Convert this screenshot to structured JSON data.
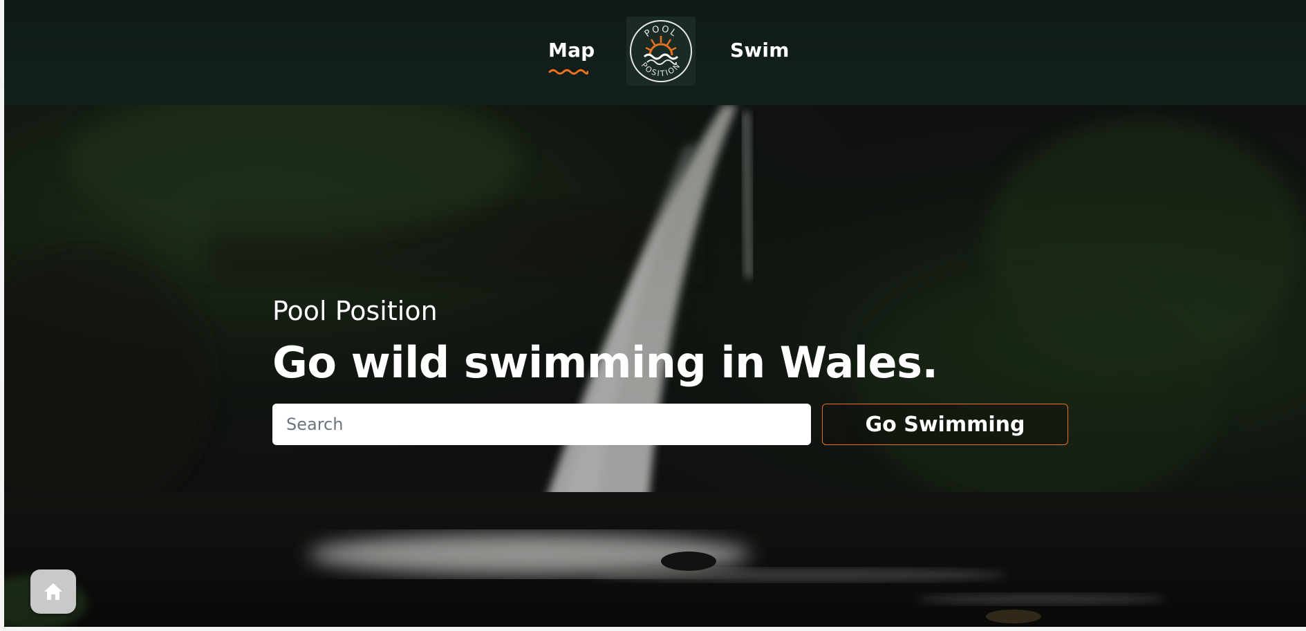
{
  "nav": {
    "map_label": "Map",
    "swim_label": "Swim",
    "active": "Map"
  },
  "logo": {
    "text_top": "POOL",
    "text_bottom": "POSITION"
  },
  "hero": {
    "subtitle": "Pool Position",
    "headline": "Go wild swimming in Wales.",
    "search_placeholder": "Search",
    "search_value": "",
    "cta_label": "Go Swimming"
  },
  "icons": {
    "home_button": "home-icon",
    "active_underline": "wave-underline"
  },
  "colors": {
    "header_bg": "#0f1a17",
    "accent": "#e8721e",
    "text": "#ffffff",
    "home_button_bg": "#c9c9c9"
  }
}
